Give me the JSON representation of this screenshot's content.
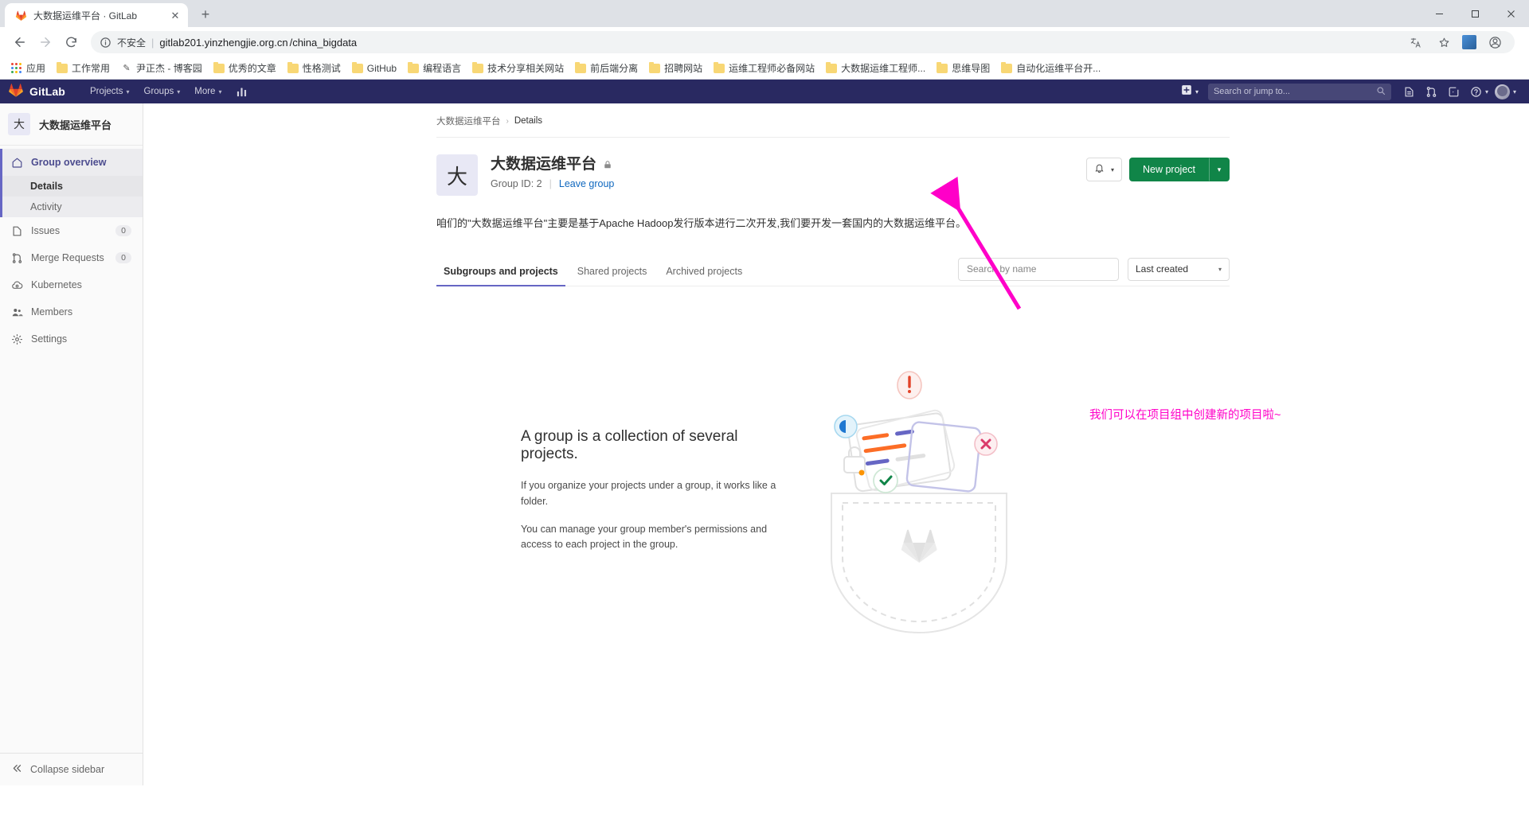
{
  "browser": {
    "tab": {
      "title": "大数据运维平台 · GitLab",
      "favicon": "gitlab-favicon",
      "close_label": "✕"
    },
    "new_tab_label": "+",
    "window_controls": {
      "minimize": "−",
      "maximize": "▢",
      "close": "✕"
    },
    "nav": {
      "back": "←",
      "forward": "→",
      "reload": "⟳"
    },
    "omnibox": {
      "security_label": "不安全",
      "url_host": "gitlab201.yinzhengjie.org.cn",
      "url_path": "/china_bigdata",
      "translate_icon": "translate-icon",
      "bookmark_icon": "star-icon",
      "extension_icon": "extension-icon",
      "profile_icon": "profile-icon"
    },
    "bookmarks": {
      "apps_label": "应用",
      "items": [
        {
          "label": "工作常用",
          "icon": "folder-icon"
        },
        {
          "label": "尹正杰 - 博客园",
          "icon": "site-favicon"
        },
        {
          "label": "优秀的文章",
          "icon": "folder-icon"
        },
        {
          "label": "性格测试",
          "icon": "folder-icon"
        },
        {
          "label": "GitHub",
          "icon": "folder-icon"
        },
        {
          "label": "编程语言",
          "icon": "folder-icon"
        },
        {
          "label": "技术分享相关网站",
          "icon": "folder-icon"
        },
        {
          "label": "前后端分离",
          "icon": "folder-icon"
        },
        {
          "label": "招聘网站",
          "icon": "folder-icon"
        },
        {
          "label": "运维工程师必备网站",
          "icon": "folder-icon"
        },
        {
          "label": "大数据运维工程师...",
          "icon": "folder-icon"
        },
        {
          "label": "思维导图",
          "icon": "folder-icon"
        },
        {
          "label": "自动化运维平台开...",
          "icon": "folder-icon"
        }
      ]
    }
  },
  "gitlab": {
    "brand": "GitLab",
    "nav_items": [
      {
        "label": "Projects",
        "caret": "▾"
      },
      {
        "label": "Groups",
        "caret": "▾"
      },
      {
        "label": "More",
        "caret": "▾"
      }
    ],
    "analytics_icon": "analytics-icon",
    "plus": {
      "icon": "plus-square-icon",
      "caret": "▾"
    },
    "search_placeholder": "Search or jump to...",
    "right_icons": [
      {
        "name": "issues-icon"
      },
      {
        "name": "merge-requests-icon"
      },
      {
        "name": "todos-icon"
      },
      {
        "name": "help-icon"
      }
    ],
    "user_caret": "▾"
  },
  "sidebar": {
    "group_initial": "大",
    "group_name": "大数据运维平台",
    "overview_label": "Group overview",
    "sub_items": [
      {
        "label": "Details",
        "current": true
      },
      {
        "label": "Activity",
        "current": false
      }
    ],
    "items": [
      {
        "label": "Issues",
        "icon": "issues-icon",
        "badge": "0"
      },
      {
        "label": "Merge Requests",
        "icon": "merge-request-icon",
        "badge": "0"
      },
      {
        "label": "Kubernetes",
        "icon": "kubernetes-icon",
        "badge": ""
      },
      {
        "label": "Members",
        "icon": "members-icon",
        "badge": ""
      },
      {
        "label": "Settings",
        "icon": "gear-icon",
        "badge": ""
      }
    ],
    "collapse_label": "Collapse sidebar"
  },
  "main": {
    "breadcrumb": {
      "group": "大数据运维平台",
      "separator": "›",
      "current": "Details"
    },
    "group_initial": "大",
    "group_title": "大数据运维平台",
    "lock_icon": "lock-icon",
    "group_id_label": "Group ID: 2",
    "leave_group_label": "Leave group",
    "notification_icon": "bell-icon",
    "notification_caret": "▾",
    "new_project_label": "New project",
    "new_project_caret": "▾",
    "description": "咱们的\"大数据运维平台\"主要是基于Apache Hadoop发行版本进行二次开发,我们要开发一套国内的大数据运维平台。",
    "tabs": [
      {
        "label": "Subgroups and projects",
        "active": true
      },
      {
        "label": "Shared projects",
        "active": false
      },
      {
        "label": "Archived projects",
        "active": false
      }
    ],
    "search_placeholder": "Search by name",
    "sort_value": "Last created",
    "sort_caret": "▾",
    "empty_state": {
      "title": "A group is a collection of several projects.",
      "paragraph1": "If you organize your projects under a group, it works like a folder.",
      "paragraph2": "You can manage your group member's permissions and access to each project in the group."
    }
  },
  "annotation": {
    "text": "我们可以在项目组中创建新的项目啦~",
    "color": "#ff00c8"
  }
}
